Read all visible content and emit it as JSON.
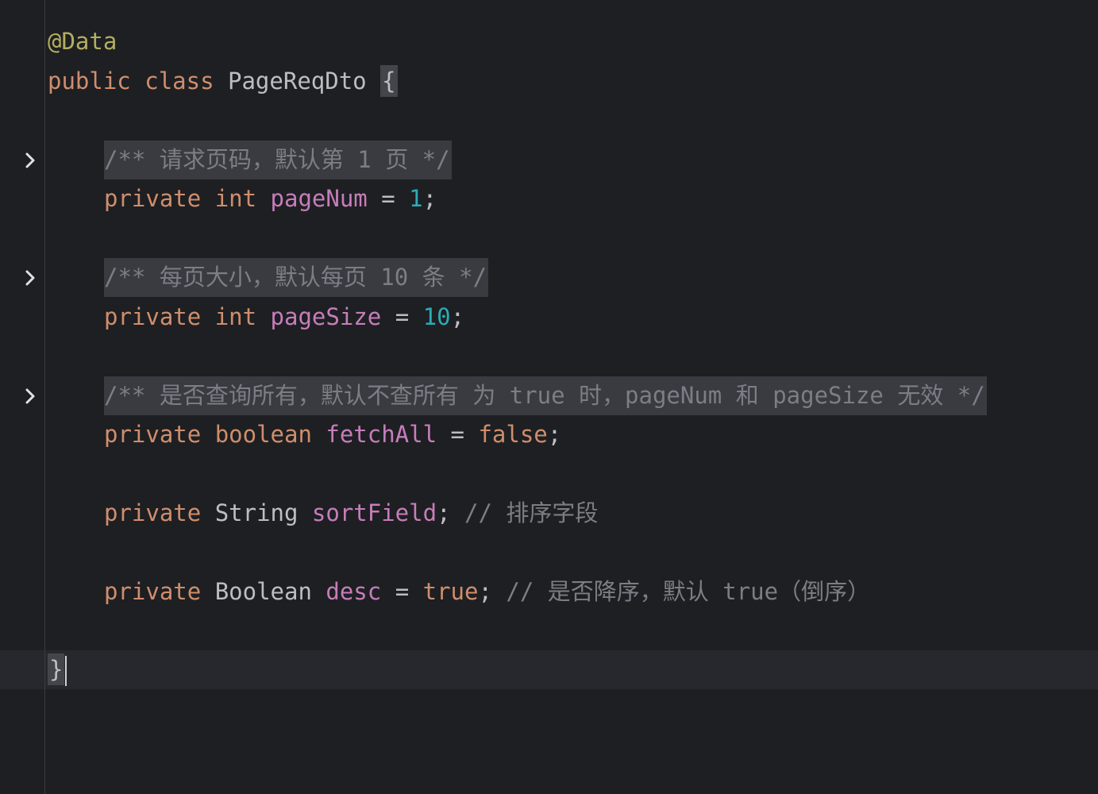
{
  "editor": {
    "lines": {
      "annotation": "@Data",
      "class_decl": {
        "kw_public": "public",
        "kw_class": "class",
        "name": "PageReqDto",
        "open_brace": "{"
      },
      "doc1": "/** 请求页码，默认第 1 页 */",
      "field1": {
        "modifier": "private",
        "type": "int",
        "name": "pageNum",
        "op": "=",
        "value": "1",
        "end": ";"
      },
      "doc2": "/** 每页大小，默认每页 10 条 */",
      "field2": {
        "modifier": "private",
        "type": "int",
        "name": "pageSize",
        "op": "=",
        "value": "10",
        "end": ";"
      },
      "doc3": "/** 是否查询所有，默认不查所有 为 true 时，pageNum 和 pageSize 无效 */",
      "field3": {
        "modifier": "private",
        "type": "boolean",
        "name": "fetchAll",
        "op": "=",
        "value": "false",
        "end": ";"
      },
      "field4": {
        "modifier": "private",
        "type": "String",
        "name": "sortField",
        "end": ";",
        "comment": "// 排序字段"
      },
      "field5": {
        "modifier": "private",
        "type": "Boolean",
        "name": "desc",
        "op": "=",
        "value": "true",
        "end": ";",
        "comment": "// 是否降序，默认 true（倒序）"
      },
      "close_brace": "}"
    },
    "icons": {
      "fold": "chevron-right-icon"
    }
  }
}
